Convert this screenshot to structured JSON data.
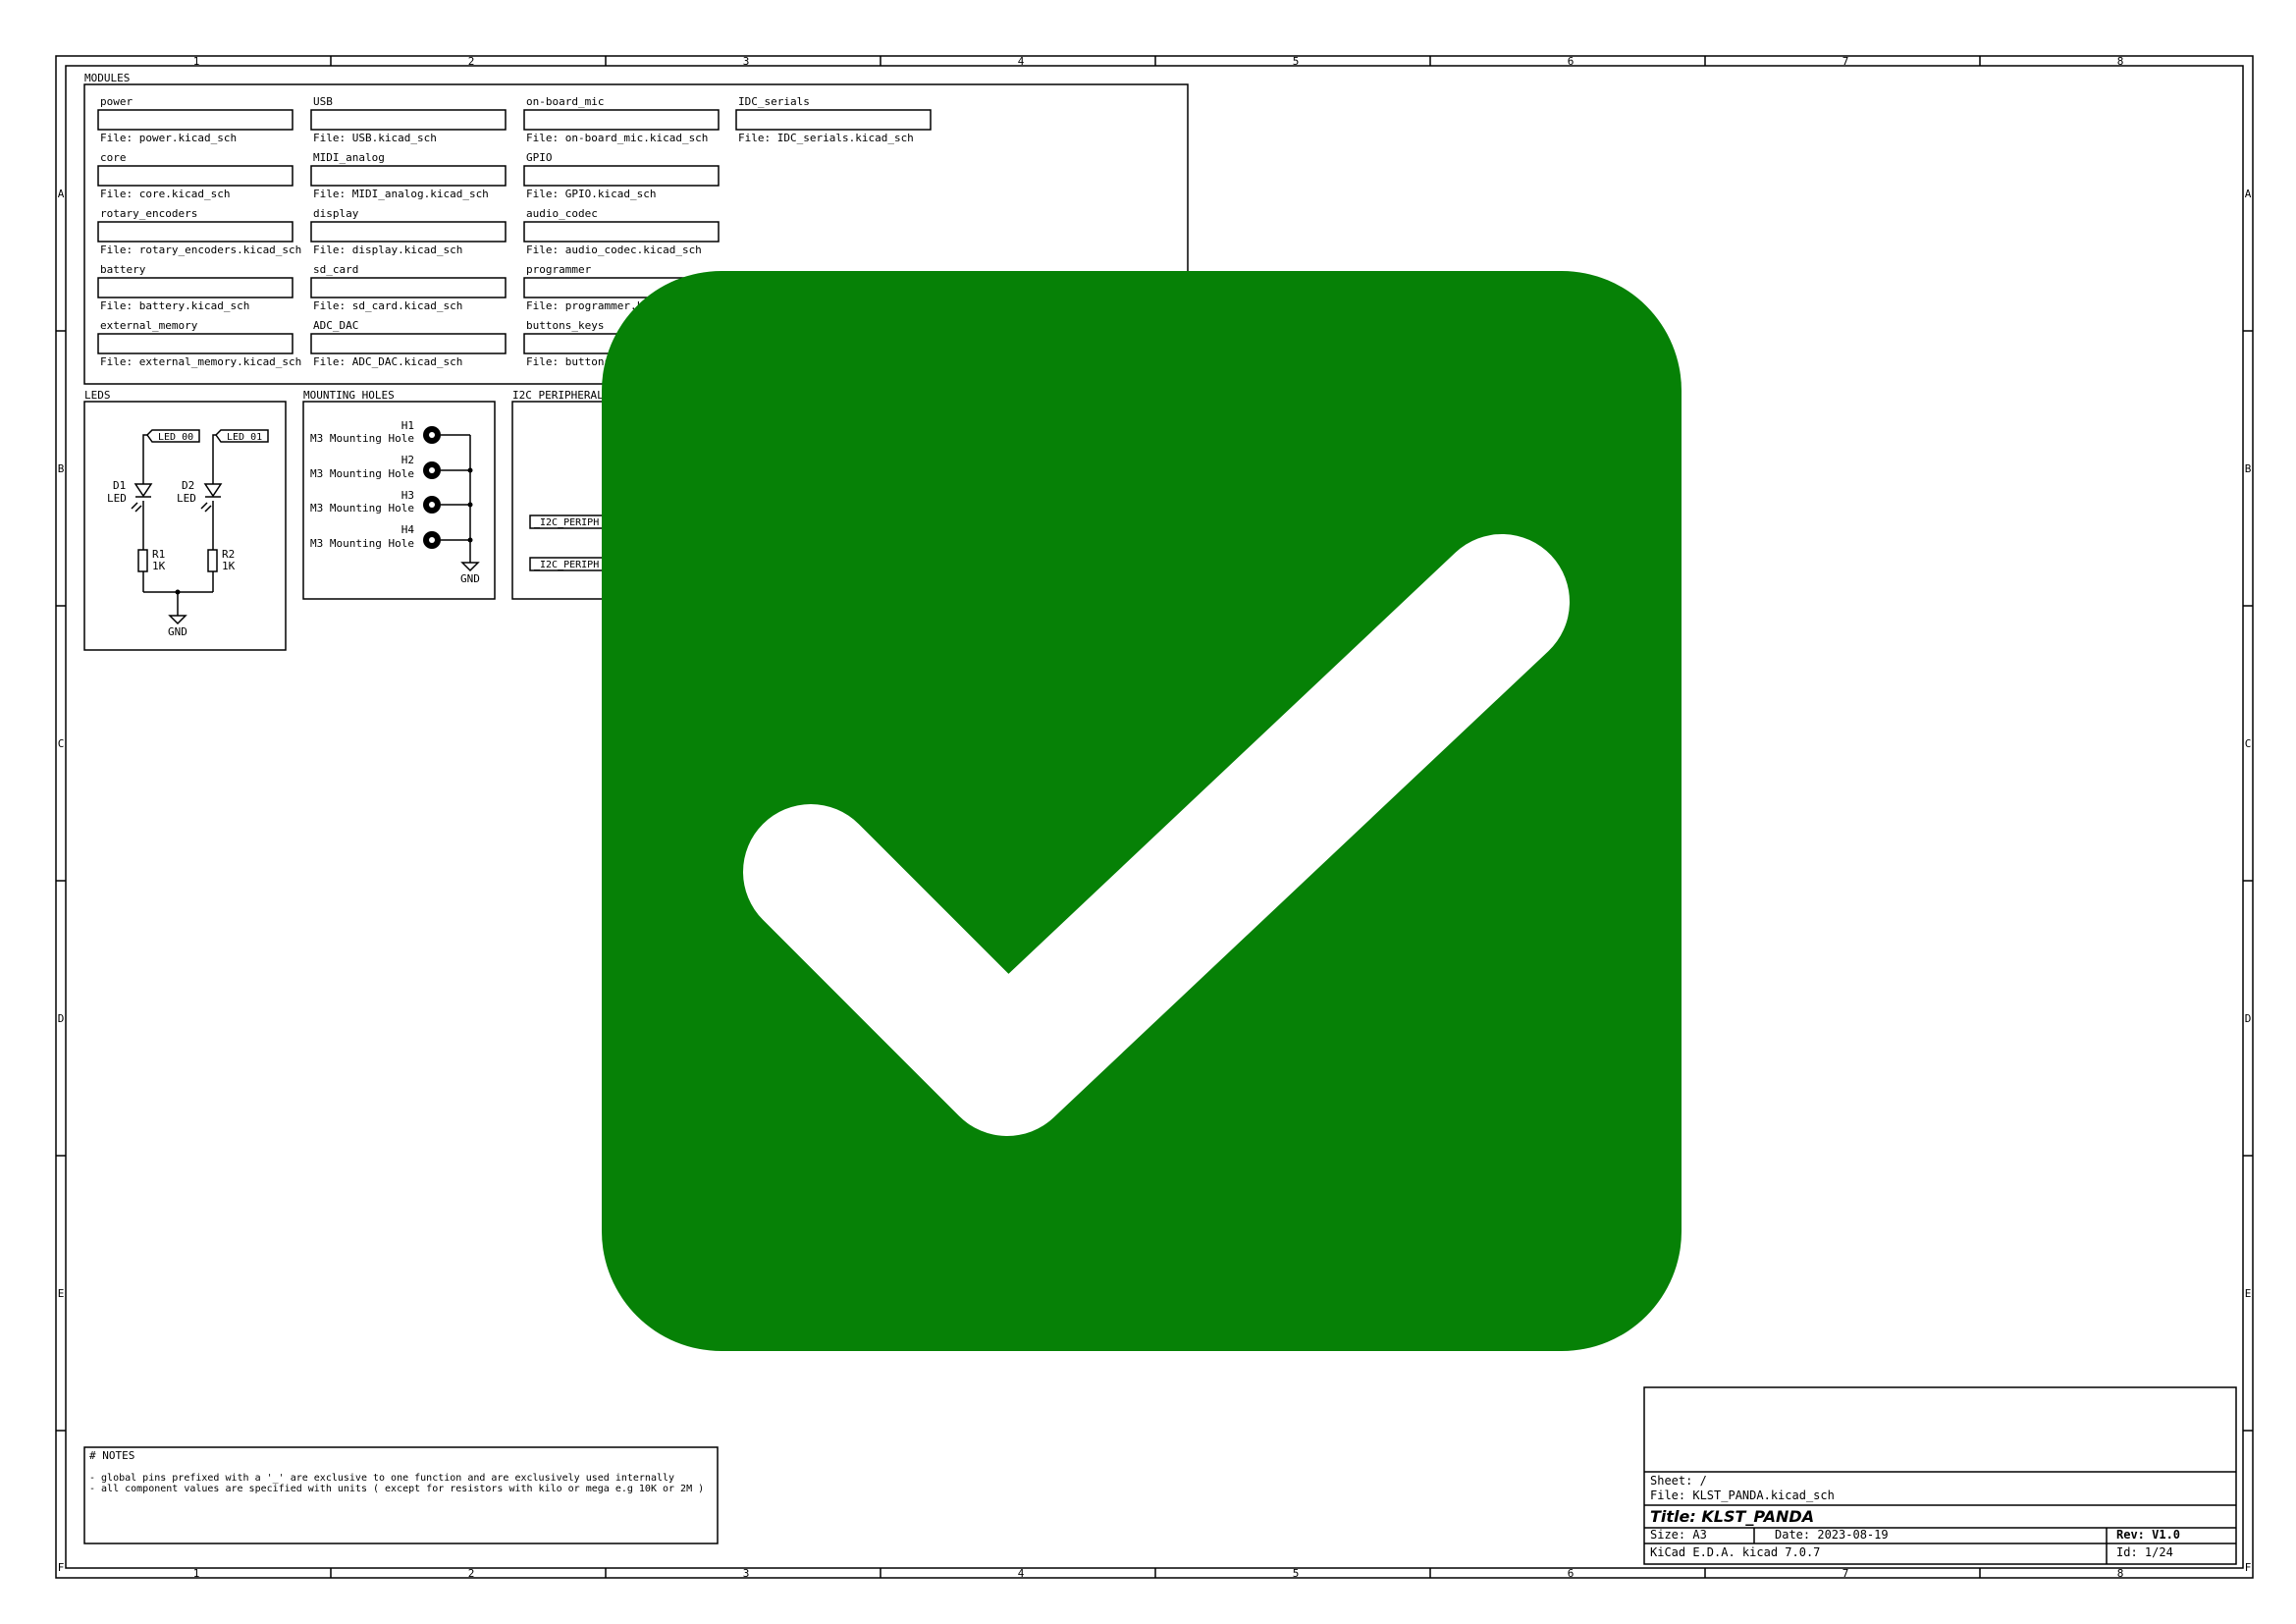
{
  "border": {
    "columns": [
      "1",
      "2",
      "3",
      "4",
      "5",
      "6",
      "7",
      "8"
    ],
    "rows": [
      "A",
      "B",
      "C",
      "D",
      "E",
      "F"
    ]
  },
  "modules": {
    "title": "MODULES",
    "sheets": [
      {
        "name": "power",
        "file": "File: power.kicad_sch"
      },
      {
        "name": "USB",
        "file": "File: USB.kicad_sch"
      },
      {
        "name": "on-board_mic",
        "file": "File: on-board_mic.kicad_sch"
      },
      {
        "name": "IDC_serials",
        "file": "File: IDC_serials.kicad_sch"
      },
      {
        "name": "core",
        "file": "File: core.kicad_sch"
      },
      {
        "name": "MIDI_analog",
        "file": "File: MIDI_analog.kicad_sch"
      },
      {
        "name": "GPIO",
        "file": "File: GPIO.kicad_sch"
      },
      {
        "name": "rotary_encoders",
        "file": "File: rotary_encoders.kicad_sch"
      },
      {
        "name": "display",
        "file": "File: display.kicad_sch"
      },
      {
        "name": "audio_codec",
        "file": "File: audio_codec.kicad_sch"
      },
      {
        "name": "battery",
        "file": "File: battery.kicad_sch"
      },
      {
        "name": "sd_card",
        "file": "File: sd_card.kicad_sch"
      },
      {
        "name": "programmer",
        "file": "File: programmer.kica"
      },
      {
        "name": "external_memory",
        "file": "File: external_memory.kicad_sch"
      },
      {
        "name": "ADC_DAC",
        "file": "File: ADC_DAC.kicad_sch"
      },
      {
        "name": "buttons_keys",
        "file": "File: buttons_ke"
      }
    ]
  },
  "leds": {
    "title": "LEDS",
    "labels": [
      "_LED_00",
      "_LED_01"
    ],
    "diodes": [
      {
        "ref": "D1",
        "value": "LED"
      },
      {
        "ref": "D2",
        "value": "LED"
      }
    ],
    "resistors": [
      {
        "ref": "R1",
        "value": "1K"
      },
      {
        "ref": "R2",
        "value": "1K"
      }
    ],
    "gnd": "GND"
  },
  "mounting_holes": {
    "title": "MOUNTING HOLES",
    "holes": [
      {
        "ref": "H1",
        "value": "M3 Mounting Hole"
      },
      {
        "ref": "H2",
        "value": "M3 Mounting Hole"
      },
      {
        "ref": "H3",
        "value": "M3 Mounting Hole"
      },
      {
        "ref": "H4",
        "value": "M3 Mounting Hole"
      }
    ],
    "gnd": "GND"
  },
  "i2c": {
    "title": "I2C PERIPHERAL",
    "labels": [
      "_I2C_PERIPH",
      "_I2C_PERIPH"
    ]
  },
  "notes": {
    "title": "# NOTES",
    "lines": [
      "- global pins prefixed with a '_' are exclusive to one function and are exclusively used internally",
      "- all component values are specified with units ( except for resistors with kilo or mega e.g 10K or 2M )"
    ]
  },
  "title_block": {
    "sheet": "Sheet: /",
    "file": "File: KLST_PANDA.kicad_sch",
    "title": "Title: KLST_PANDA",
    "size": "Size: A3",
    "date": "Date: 2023-08-19",
    "rev": "Rev: V1.0",
    "tool": "KiCad E.D.A.  kicad 7.0.7",
    "id": "Id: 1/24"
  },
  "overlay": {
    "icon": "checkmark-icon",
    "background_color": "#068106",
    "mark_color": "#ffffff"
  }
}
